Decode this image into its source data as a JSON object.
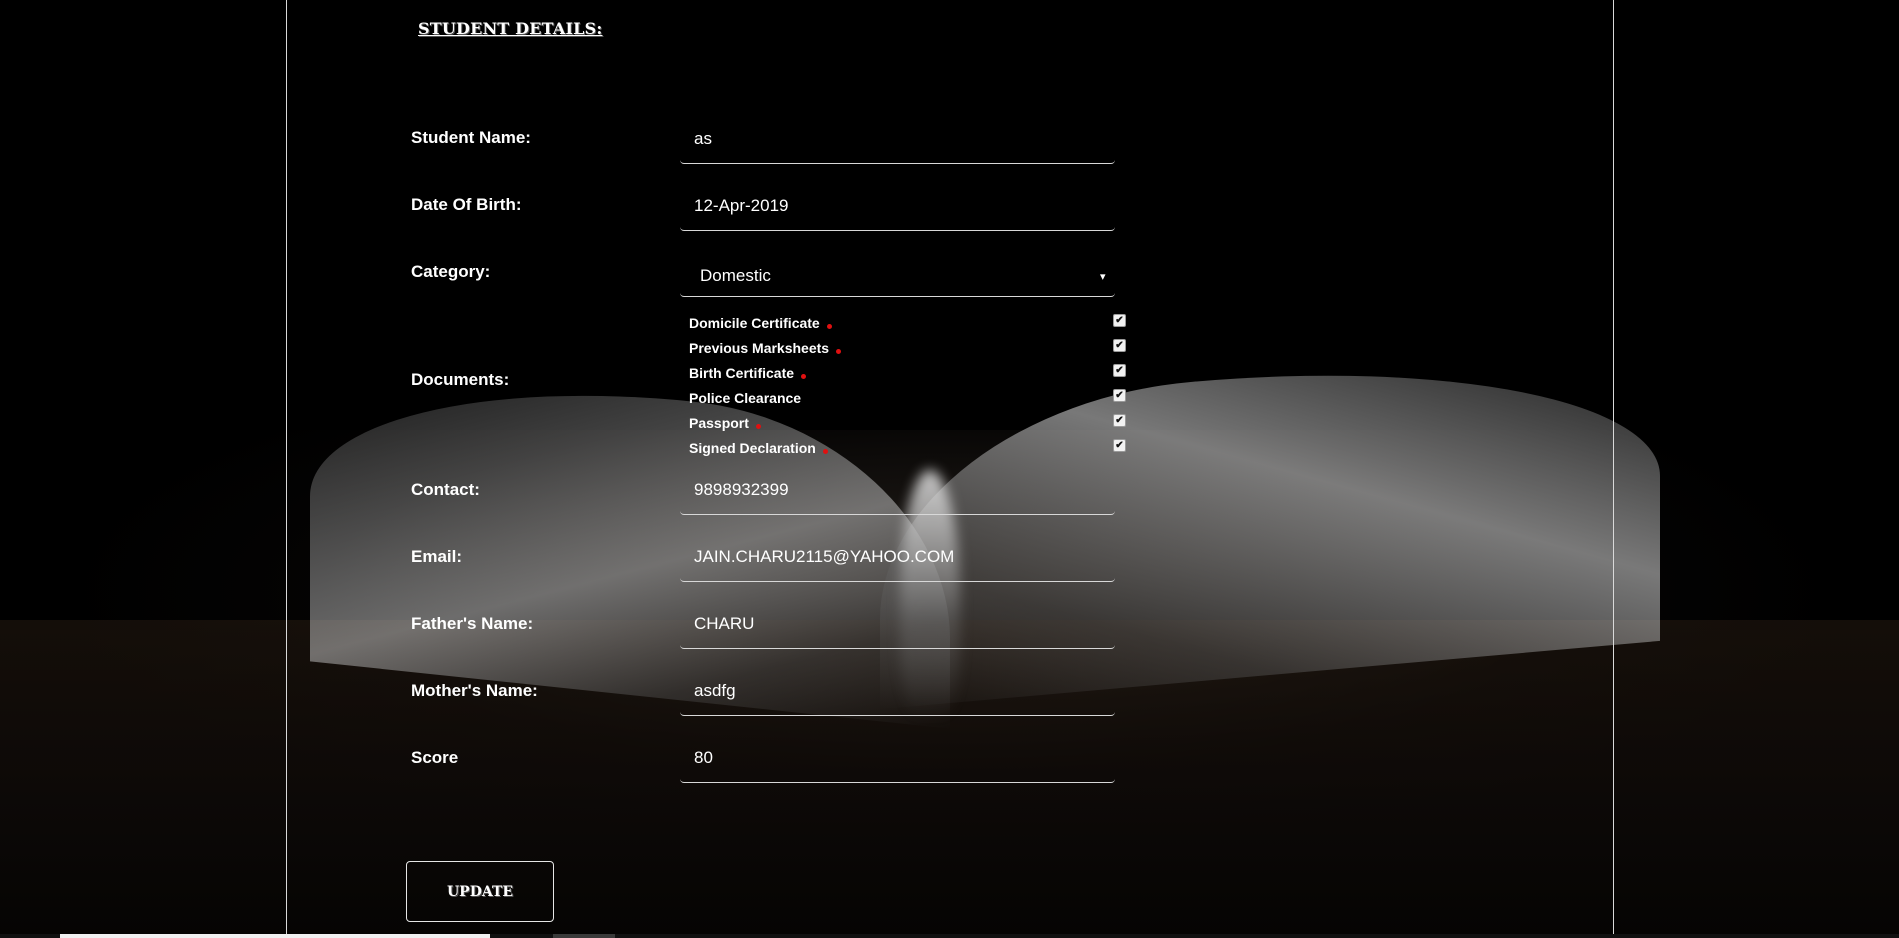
{
  "section_title": "STUDENT DETAILS:",
  "fields": {
    "student_name": {
      "label": "Student Name:",
      "value": "as"
    },
    "dob": {
      "label": "Date Of Birth:",
      "value": "12-Apr-2019"
    },
    "category": {
      "label": "Category:",
      "value": "Domestic",
      "arrow": "▾"
    },
    "contact": {
      "label": "Contact:",
      "value": "9898932399"
    },
    "email": {
      "label": "Email:",
      "value": "JAIN.CHARU2115@YAHOO.COM"
    },
    "father_name": {
      "label": "Father's Name:",
      "value": "CHARU"
    },
    "mother_name": {
      "label": "Mother's Name:",
      "value": "asdfg"
    },
    "score": {
      "label": "Score",
      "value": "80"
    }
  },
  "documents": {
    "label": "Documents:",
    "items": [
      {
        "label": "Domicile Certificate",
        "required": true,
        "checked": true
      },
      {
        "label": "Previous Marksheets",
        "required": true,
        "checked": true
      },
      {
        "label": "Birth Certificate",
        "required": true,
        "checked": true
      },
      {
        "label": "Police Clearance",
        "required": false,
        "checked": true
      },
      {
        "label": "Passport",
        "required": true,
        "checked": true
      },
      {
        "label": "Signed Declaration",
        "required": true,
        "checked": true
      }
    ],
    "check_mark": "✔",
    "required_dot_color": "#e01010"
  },
  "update_button": "UPDATE"
}
